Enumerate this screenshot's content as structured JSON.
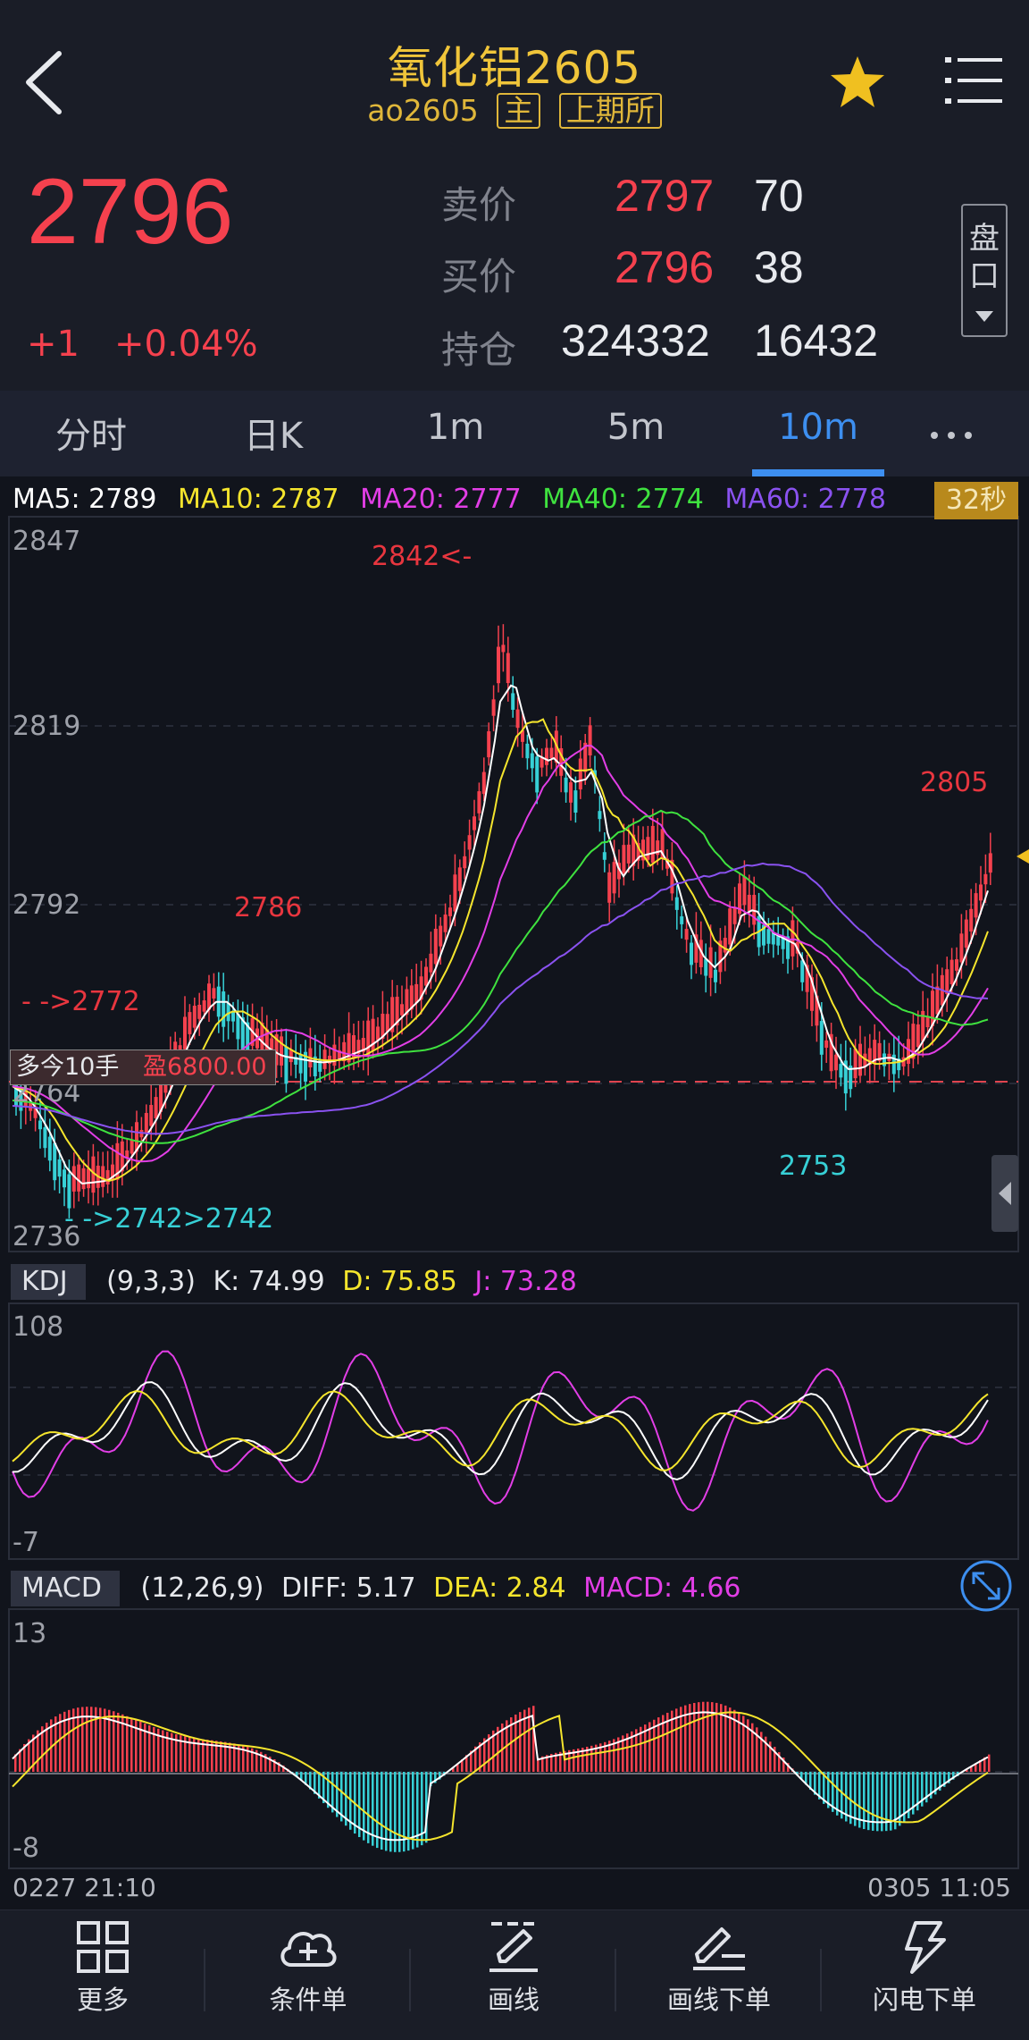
{
  "header": {
    "title": "氧化铝2605",
    "code": "ao2605",
    "tag_main": "主",
    "tag_exchange": "上期所"
  },
  "quote": {
    "last_price": "2796",
    "change_abs": "+1",
    "change_pct": "+0.04%",
    "ask_label": "卖价",
    "ask_price": "2797",
    "ask_volume": "70",
    "bid_label": "买价",
    "bid_price": "2796",
    "bid_volume": "38",
    "oi_label": "持仓",
    "open_interest": "324332",
    "oi_change": "16432",
    "pankou_line1": "盘",
    "pankou_line2": "口"
  },
  "tabs": [
    {
      "label": "分时"
    },
    {
      "label": "日K"
    },
    {
      "label": "1m"
    },
    {
      "label": "5m"
    },
    {
      "label": "10m",
      "active": true
    }
  ],
  "main_chart": {
    "ma_legend": [
      {
        "text": "MA5: 2789",
        "color": "#ffffff"
      },
      {
        "text": "MA10: 2787",
        "color": "#f5e52d"
      },
      {
        "text": "MA20: 2777",
        "color": "#e23ee6"
      },
      {
        "text": "MA40: 2774",
        "color": "#3fe23f"
      },
      {
        "text": "MA60: 2778",
        "color": "#8a52f0"
      }
    ],
    "timer": "32秒",
    "y_labels": [
      "2847",
      "2819",
      "2792",
      "2764",
      "2736"
    ],
    "annotations": {
      "high": "2842<-",
      "peak_2805": "2805",
      "peak_2786": "2786",
      "left_2772": "- ->2772",
      "low_2753": "2753",
      "low_2742": "- ->2742>2742"
    },
    "position_text": "多今10手",
    "profit_text": "盈6800.00"
  },
  "kdj": {
    "name": "KDJ",
    "params": "(9,3,3)",
    "k": "K: 74.99",
    "d": "D: 75.85",
    "j": "J: 73.28",
    "y_top": "108",
    "y_bottom": "-7"
  },
  "macd": {
    "name": "MACD",
    "params": "(12,26,9)",
    "diff": "DIFF: 5.17",
    "dea": "DEA: 2.84",
    "macd": "MACD: 4.66",
    "y_top": "13",
    "y_bottom": "-8"
  },
  "time_axis": {
    "start": "0227 21:10",
    "end": "0305 11:05"
  },
  "bottom_bar": {
    "more": "更多",
    "condition": "条件单",
    "draw": "画线",
    "draw_order": "画线下单",
    "flash_order": "闪电下单"
  },
  "colors": {
    "up": "#f5414e",
    "down": "#37d0d6",
    "accent": "#3d8ff0",
    "gold": "#f0c53a"
  }
}
